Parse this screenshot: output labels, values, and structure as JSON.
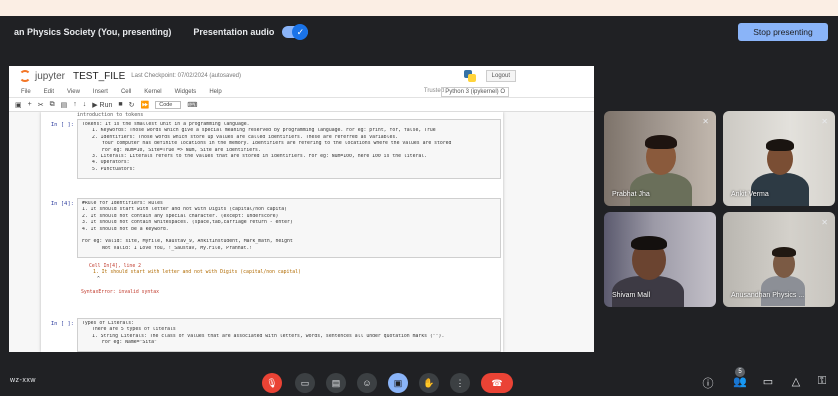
{
  "presentation_bar": {
    "title": "an Physics Society (You, presenting)",
    "audio_label": "Presentation audio",
    "audio_on": true,
    "stop_label": "Stop presenting"
  },
  "jupyter": {
    "brand": "jupyter",
    "filename": "TEST_FILE",
    "checkpoint": "Last Checkpoint: 07/02/2024  (autosaved)",
    "logout": "Logout",
    "menu": [
      "File",
      "Edit",
      "View",
      "Insert",
      "Cell",
      "Kernel",
      "Widgets",
      "Help"
    ],
    "trusted": "Trusted",
    "kernel": "Python 3 (ipykernel) O",
    "toolbar_run": "Run",
    "cell_type": "Code",
    "top_fragment": "introduction to tokens",
    "cell1": {
      "prompt": "In [ ]:",
      "lines": [
        "Tokens: It is the smallest unit in a programming language.",
        "1. Keywords: Those words which give a special meaning reserved by programming language. For eg: print, for, false, True",
        "2. Identifiers: Those words which store up values are called identifiers. These are referred as variables.",
        "Your computer has definite locations in the memory. Identifiers are refering to the locations where the values are stored",
        "For eg: Num=10, Site=True => Num, Site are identifiers.",
        "3. Literals: Literals refers to the values that are stored in identifiers. For eg: Num=100, here 100 is the literal.",
        "4. Operators:",
        "5. Punctuators:"
      ]
    },
    "cell2": {
      "prompt": "In [4]:",
      "lines": [
        "#Rule for Identifiers: Rules",
        "1. It should start with letter and not with Digits (capital/non capita)",
        "2. It should not contain any special character. (except: underscore)",
        "3. It should not contain whitespaces. (space,tab,carriage return - enter)",
        "4. It should not be a keyword.",
        "",
        "For eg: Valid: site, MyFile, Kaustav_9, AnkitInstudent, Mark_math, height",
        "Not Valid: 1 Love You, !_Saustav, My.File, Pranhat.!"
      ],
      "output": [
        "Cell In[4], line 2",
        "1. It should start with letter and not with Digits (capital/non capital)",
        "^",
        "SyntaxError: invalid syntax"
      ]
    },
    "cell3": {
      "prompt": "In [ ]:",
      "lines": [
        "Types of Literals:",
        "There are 5 types of literals",
        "1. String Literals: The class of values that are associated with letters, words, sentences all under quotation marks (\"\").",
        "For eg: Name=\"Sita\""
      ]
    }
  },
  "participants": [
    {
      "name": "Prabhat Jha",
      "muted": true
    },
    {
      "name": "Ankit Verma",
      "muted": true
    },
    {
      "name": "Shivam Mall",
      "muted": false
    },
    {
      "name": "Anusandhan Physics ...",
      "muted": true
    }
  ],
  "bottom_bar": {
    "meeting_code": "wz-xxw",
    "people_count": "5"
  },
  "icons": {
    "mic": "mic-off-icon",
    "camera": "videocam-icon",
    "captions": "closed-caption-icon",
    "emoji": "emoji-icon",
    "present": "present-to-all-icon",
    "hand": "raise-hand-icon",
    "more": "more-vert-icon",
    "hangup": "call-end-icon",
    "info": "info-icon",
    "people": "people-icon",
    "chat": "chat-icon",
    "activities": "activities-icon",
    "host": "host-controls-icon"
  },
  "colors": {
    "accent": "#8ab4f8",
    "danger": "#ea4335",
    "background": "#202124"
  }
}
